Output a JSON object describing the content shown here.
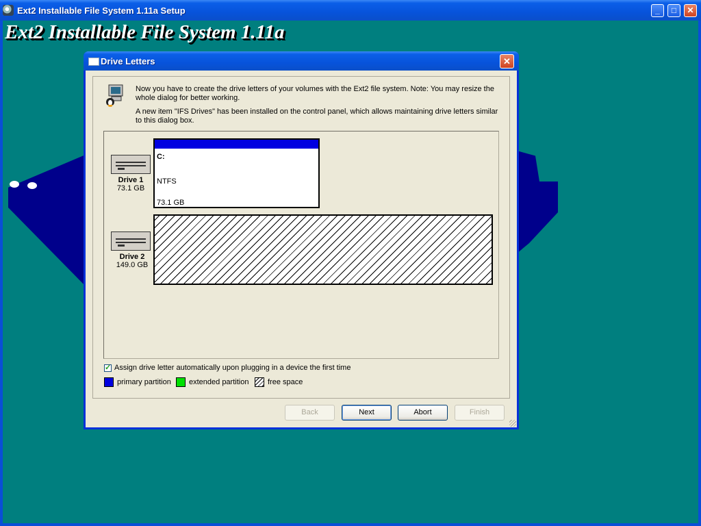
{
  "outer_window": {
    "title": "Ext2 Installable File System 1.11a Setup",
    "banner": "Ext2 Installable File System 1.11a",
    "minimize": "_",
    "maximize": "□",
    "close": "✕"
  },
  "dialog": {
    "title": "Drive Letters",
    "close": "✕",
    "message1": "Now you have to create the drive letters of your volumes with the Ext2 file system. Note: You may resize the whole dialog for better working.",
    "message2": "A new item \"IFS Drives\" has been installed on the control panel, which allows maintaining drive letters similar to this dialog box.",
    "drives": [
      {
        "name": "Drive 1",
        "size": "73.1 GB"
      },
      {
        "name": "Drive 2",
        "size": "149.0 GB"
      }
    ],
    "partition1": {
      "letter": "C:",
      "filesystem": "NTFS",
      "size": "73.1 GB"
    },
    "auto_assign_label": "Assign drive letter automatically upon plugging in a device the first time",
    "auto_assign_checked": true,
    "legend": {
      "primary": "primary partition",
      "extended": "extended partition",
      "free": "free space"
    },
    "colors": {
      "primary": "#0000e0",
      "extended": "#00e000"
    },
    "buttons": {
      "back": "Back",
      "next": "Next",
      "abort": "Abort",
      "finish": "Finish"
    }
  }
}
